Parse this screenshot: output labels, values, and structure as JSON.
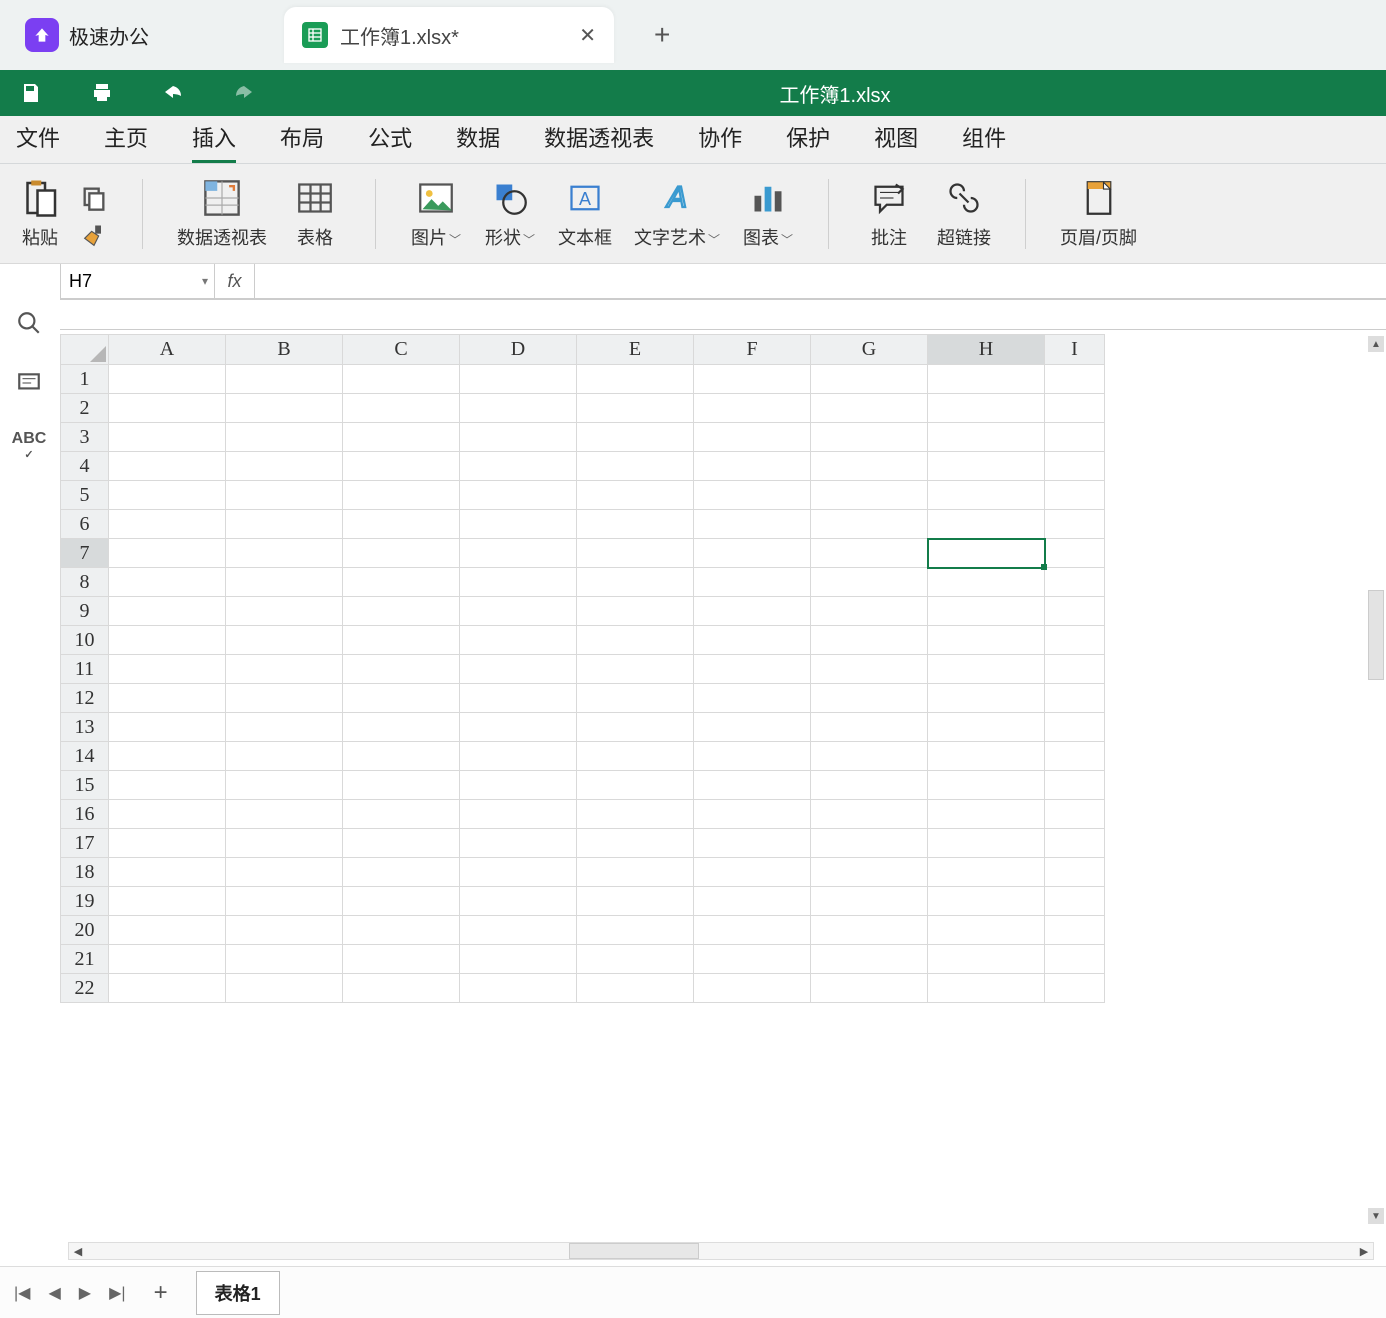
{
  "app": {
    "name": "极速办公"
  },
  "tab": {
    "title": "工作簿1.xlsx*"
  },
  "document": {
    "title": "工作簿1.xlsx"
  },
  "menu": {
    "items": [
      "文件",
      "主页",
      "插入",
      "布局",
      "公式",
      "数据",
      "数据透视表",
      "协作",
      "保护",
      "视图",
      "组件"
    ],
    "active_index": 2
  },
  "ribbon": {
    "paste": "粘贴",
    "pivot": "数据透视表",
    "table": "表格",
    "image": "图片",
    "shape": "形状",
    "textbox": "文本框",
    "textart": "文字艺术",
    "chart": "图表",
    "comment": "批注",
    "link": "超链接",
    "headerfooter": "页眉/页脚"
  },
  "formula_bar": {
    "cell_ref": "H7",
    "fx_label": "fx",
    "formula": ""
  },
  "grid": {
    "columns": [
      "A",
      "B",
      "C",
      "D",
      "E",
      "F",
      "G",
      "H",
      "I"
    ],
    "rows": [
      1,
      2,
      3,
      4,
      5,
      6,
      7,
      8,
      9,
      10,
      11,
      12,
      13,
      14,
      15,
      16,
      17,
      18,
      19,
      20,
      21,
      22
    ],
    "selected": {
      "col": "H",
      "row": 7
    }
  },
  "sheets": {
    "active": "表格1"
  }
}
